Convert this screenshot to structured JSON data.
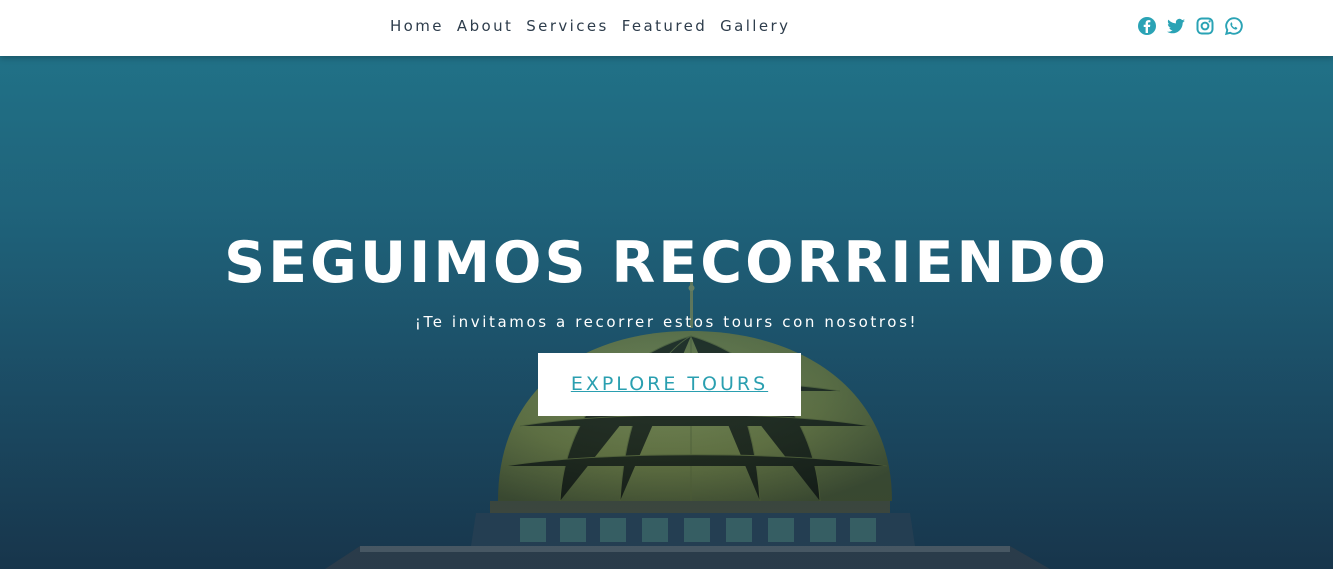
{
  "nav": {
    "items": [
      "Home",
      "About",
      "Services",
      "Featured",
      "Gallery"
    ]
  },
  "social": {
    "icons": [
      "facebook-icon",
      "twitter-icon",
      "instagram-icon",
      "whatsapp-icon"
    ],
    "color": "#2aa3b5"
  },
  "hero": {
    "title": "SEGUIMOS RECORRIENDO",
    "subtitle": "¡Te invitamos a recorrer estos tours con nosotros!",
    "cta_label": "EXPLORE TOURS",
    "overlay_color": "#216f86",
    "accent_color": "#2a9fb0"
  }
}
